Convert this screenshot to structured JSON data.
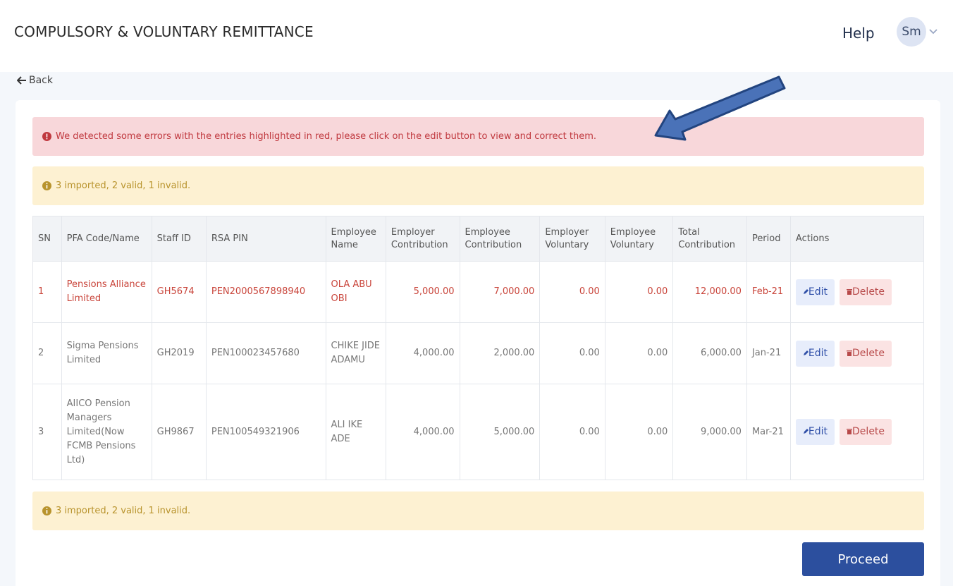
{
  "header": {
    "title": "COMPULSORY & VOLUNTARY REMITTANCE",
    "help_label": "Help",
    "avatar_initials": "Sm"
  },
  "nav": {
    "back_label": "Back"
  },
  "alerts": {
    "error_text": "We detected some errors with the entries highlighted in red, please click on the edit button to view and correct them.",
    "summary_text": "3 imported, 2 valid, 1 invalid."
  },
  "table": {
    "headers": [
      "SN",
      "PFA Code/Name",
      "Staff ID",
      "RSA PIN",
      "Employee Name",
      "Employer Contribution",
      "Employee Contribution",
      "Employer Voluntary",
      "Employee Voluntary",
      "Total Contribution",
      "Period",
      "Actions"
    ],
    "rows": [
      {
        "sn": "1",
        "pfa": "Pensions Alliance Limited",
        "staff_id": "GH5674",
        "rsa_pin": "PEN2000567898940",
        "employee_name": "OLA ABU OBI",
        "employer_contribution": "5,000.00",
        "employee_contribution": "7,000.00",
        "employer_voluntary": "0.00",
        "employee_voluntary": "0.00",
        "total_contribution": "12,000.00",
        "period": "Feb-21",
        "status": "error"
      },
      {
        "sn": "2",
        "pfa": "Sigma Pensions Limited",
        "staff_id": "GH2019",
        "rsa_pin": "PEN100023457680",
        "employee_name": "CHIKE JIDE ADAMU",
        "employer_contribution": "4,000.00",
        "employee_contribution": "2,000.00",
        "employer_voluntary": "0.00",
        "employee_voluntary": "0.00",
        "total_contribution": "6,000.00",
        "period": "Jan-21",
        "status": "valid"
      },
      {
        "sn": "3",
        "pfa": "AIICO Pension Managers Limited(Now FCMB Pensions Ltd)",
        "staff_id": "GH9867",
        "rsa_pin": "PEN100549321906",
        "employee_name": "ALI IKE ADE",
        "employer_contribution": "4,000.00",
        "employee_contribution": "5,000.00",
        "employer_voluntary": "0.00",
        "employee_voluntary": "0.00",
        "total_contribution": "9,000.00",
        "period": "Mar-21",
        "status": "valid"
      }
    ],
    "edit_label": "Edit",
    "delete_label": "Delete"
  },
  "footer": {
    "proceed_label": "Proceed"
  },
  "icons": {
    "back": "arrow-left-icon",
    "error": "exclamation-circle-icon",
    "info": "info-circle-icon",
    "edit": "pencil-icon",
    "delete": "trash-icon",
    "avatar_menu": "chevron-down-icon",
    "annotation": "annotation-arrow-icon"
  },
  "colors": {
    "error_bg": "#f8d7da",
    "error_text": "#c0393f",
    "warning_bg": "#fdf1d2",
    "warning_text": "#b8932c",
    "primary": "#2c4f9e",
    "annotation_arrow": "#4a72b8"
  }
}
